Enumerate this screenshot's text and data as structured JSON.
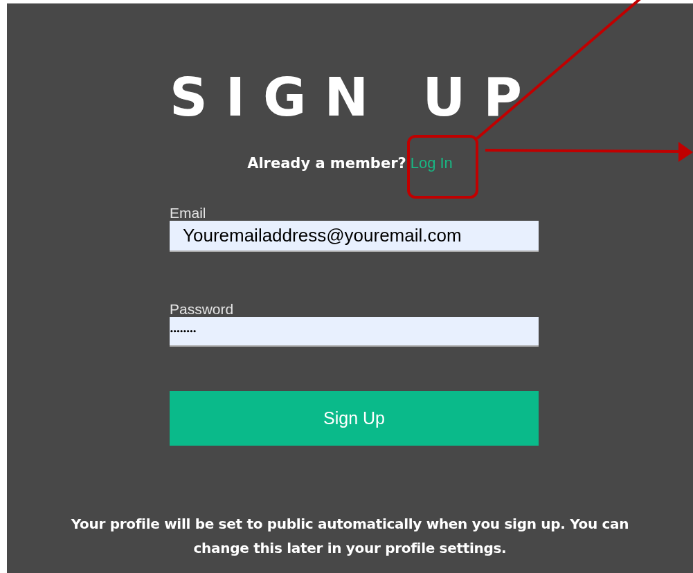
{
  "title": "SIGN UP",
  "login_prompt": {
    "text": "Already a member?",
    "link": "Log In"
  },
  "fields": [
    {
      "label": "Email",
      "value": "Youremailaddress@youremail.com",
      "kind": "text"
    },
    {
      "label": "Password",
      "value": "••••••••",
      "kind": "password"
    }
  ],
  "submit_button": "Sign Up",
  "footer_note": "Your profile will be set to public automatically when you sign up. You can change this later in your profile settings."
}
